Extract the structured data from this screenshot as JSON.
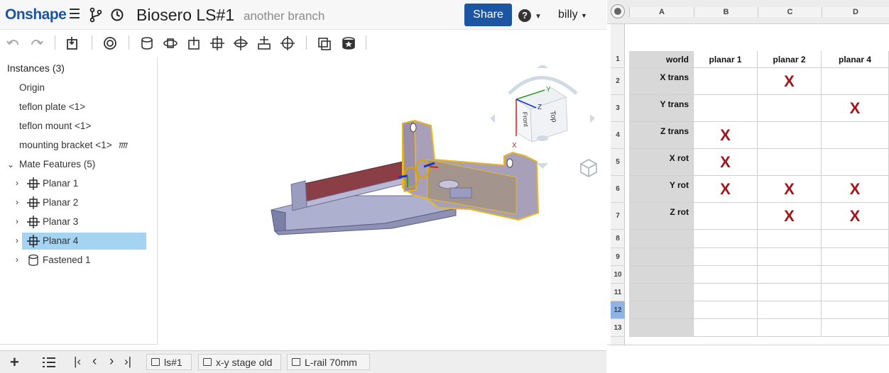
{
  "onshape": {
    "logo": "Onshape",
    "doc_title": "Biosero LS#1",
    "branch": "another branch",
    "share_label": "Share",
    "help_label": "?",
    "user_label": "billy",
    "instances_header": "Instances (3)",
    "tree": {
      "origin": "Origin",
      "teflon_plate": "teflon plate <1>",
      "teflon_mount": "teflon mount <1>",
      "mounting_bracket": "mounting bracket <1>",
      "mate_features": "Mate Features (5)",
      "planar1": "Planar 1",
      "planar2": "Planar 2",
      "planar3": "Planar 3",
      "planar4": "Planar 4",
      "fastened1": "Fastened 1"
    },
    "viewcube": {
      "front": "Front",
      "top": "Top",
      "axis_x": "X",
      "axis_y": "Y",
      "axis_z": "Z"
    },
    "tabs": [
      "ls#1",
      "x-y stage old",
      "L-rail 70mm"
    ],
    "accent_color": "#1c56a3",
    "selected_color": "#a5d3f2"
  },
  "sheet": {
    "columns": [
      "A",
      "B",
      "C",
      "D"
    ],
    "rows": [
      "1",
      "2",
      "3",
      "4",
      "5",
      "6",
      "7",
      "8",
      "9",
      "10",
      "11",
      "12",
      "13"
    ],
    "selected_row": "12",
    "headers": [
      "world",
      "planar 1",
      "planar 2",
      "planar 4"
    ],
    "data": [
      {
        "label": "X trans",
        "b": "",
        "c": "X",
        "d": ""
      },
      {
        "label": "Y trans",
        "b": "",
        "c": "",
        "d": "X"
      },
      {
        "label": "Z trans",
        "b": "X",
        "c": "",
        "d": ""
      },
      {
        "label": "X rot",
        "b": "X",
        "c": "",
        "d": ""
      },
      {
        "label": "Y rot",
        "b": "X",
        "c": "X",
        "d": "X"
      },
      {
        "label": "Z rot",
        "b": "",
        "c": "X",
        "d": "X"
      }
    ],
    "mark_color": "#a3141c"
  }
}
